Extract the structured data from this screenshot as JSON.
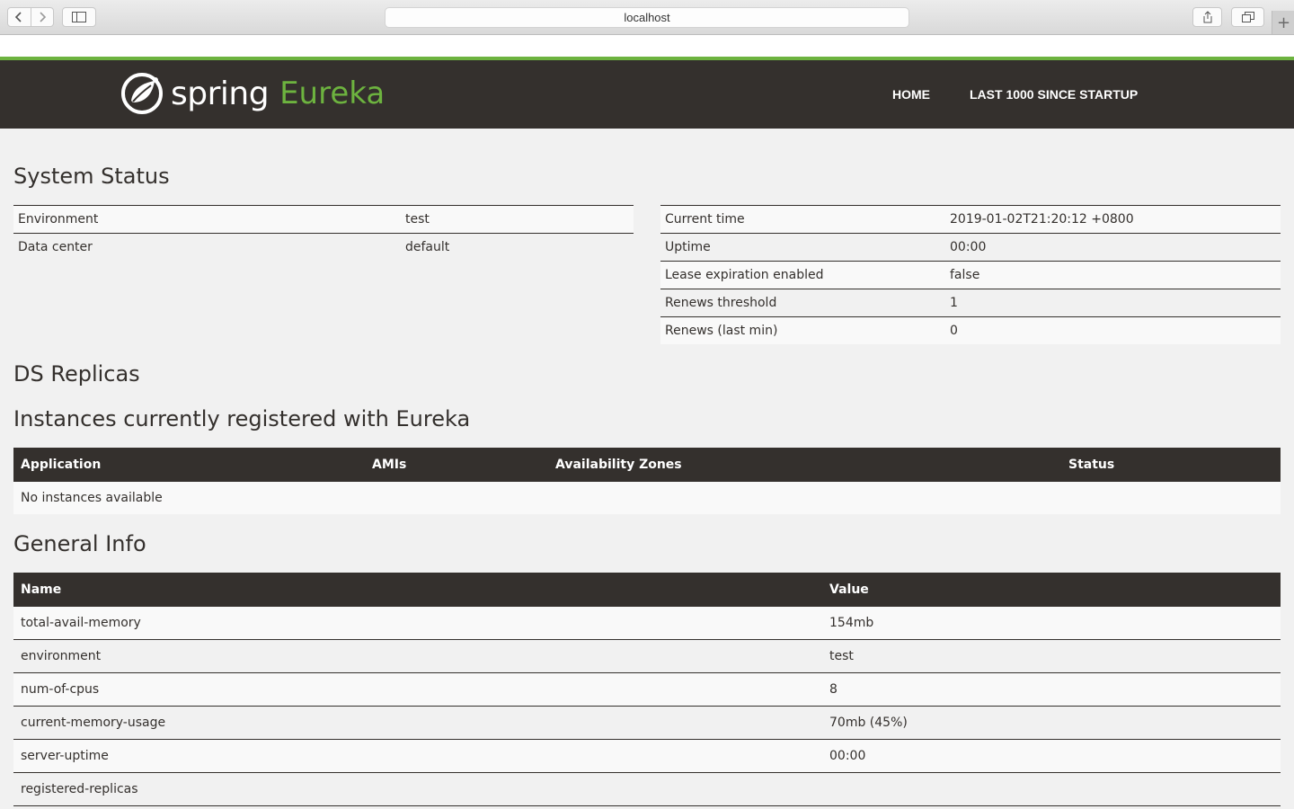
{
  "browser": {
    "url": "localhost"
  },
  "header": {
    "brand_spring": "spring",
    "brand_eureka": "Eureka",
    "nav": [
      "HOME",
      "LAST 1000 SINCE STARTUP"
    ]
  },
  "system_status": {
    "title": "System Status",
    "left": [
      {
        "label": "Environment",
        "value": "test"
      },
      {
        "label": "Data center",
        "value": "default"
      }
    ],
    "right": [
      {
        "label": "Current time",
        "value": "2019-01-02T21:20:12 +0800"
      },
      {
        "label": "Uptime",
        "value": "00:00"
      },
      {
        "label": "Lease expiration enabled",
        "value": "false"
      },
      {
        "label": "Renews threshold",
        "value": "1"
      },
      {
        "label": "Renews (last min)",
        "value": "0"
      }
    ]
  },
  "ds_replicas": {
    "title": "DS Replicas"
  },
  "instances": {
    "title": "Instances currently registered with Eureka",
    "columns": [
      "Application",
      "AMIs",
      "Availability Zones",
      "Status"
    ],
    "empty_text": "No instances available"
  },
  "general_info": {
    "title": "General Info",
    "columns": [
      "Name",
      "Value"
    ],
    "rows": [
      {
        "name": "total-avail-memory",
        "value": "154mb"
      },
      {
        "name": "environment",
        "value": "test"
      },
      {
        "name": "num-of-cpus",
        "value": "8"
      },
      {
        "name": "current-memory-usage",
        "value": "70mb (45%)"
      },
      {
        "name": "server-uptime",
        "value": "00:00"
      },
      {
        "name": "registered-replicas",
        "value": ""
      }
    ]
  },
  "colors": {
    "brand_green": "#6db33f",
    "header_dark": "#34302d"
  }
}
